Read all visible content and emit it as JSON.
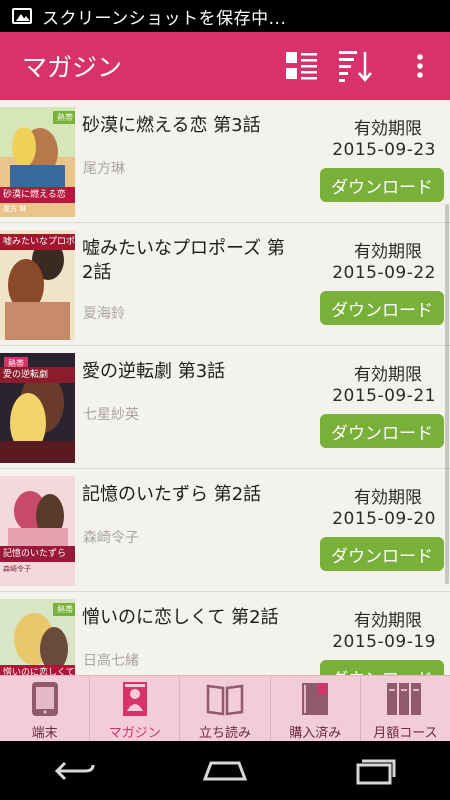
{
  "status_bar": {
    "text": "スクリーンショットを保存中...",
    "icon": "image-icon"
  },
  "app_bar": {
    "title": "マガジン",
    "actions": [
      "grid-view-icon",
      "sort-icon",
      "overflow-menu-icon"
    ],
    "color": "#d7336a"
  },
  "list": {
    "expiry_label": "有効期限",
    "download_label": "ダウンロード",
    "items": [
      {
        "title": "砂漠に燃える恋 第3話",
        "author": "尾方琳",
        "expiry": "2015-09-23",
        "cover_title": "砂漠に燃える恋",
        "cover_author": "尾方 琳"
      },
      {
        "title": "嘘みたいなプロポーズ 第2話",
        "author": "夏海鈴",
        "expiry": "2015-09-22",
        "cover_title": "嘘みたいなプロポーズ",
        "cover_author": ""
      },
      {
        "title": "愛の逆転劇 第3話",
        "author": "七星紗英",
        "expiry": "2015-09-21",
        "cover_title": "愛の逆転劇",
        "cover_author": ""
      },
      {
        "title": "記憶のいたずら 第2話",
        "author": "森崎令子",
        "expiry": "2015-09-20",
        "cover_title": "記憶のいたずら",
        "cover_author": "森崎令子"
      },
      {
        "title": "憎いのに恋しくて 第2話",
        "author": "日高七緒",
        "expiry": "2015-09-19",
        "cover_title": "憎いのに恋しくて",
        "cover_author": ""
      }
    ]
  },
  "bottom_nav": {
    "items": [
      {
        "label": "端末",
        "icon": "tablet-icon",
        "active": false
      },
      {
        "label": "マガジン",
        "icon": "magazine-icon",
        "active": true
      },
      {
        "label": "立ち読み",
        "icon": "open-book-icon",
        "active": false
      },
      {
        "label": "購入済み",
        "icon": "bookmark-book-icon",
        "active": false
      },
      {
        "label": "月額コース",
        "icon": "books-icon",
        "active": false
      }
    ]
  },
  "system_nav": [
    "back-icon",
    "home-icon",
    "recents-icon"
  ]
}
